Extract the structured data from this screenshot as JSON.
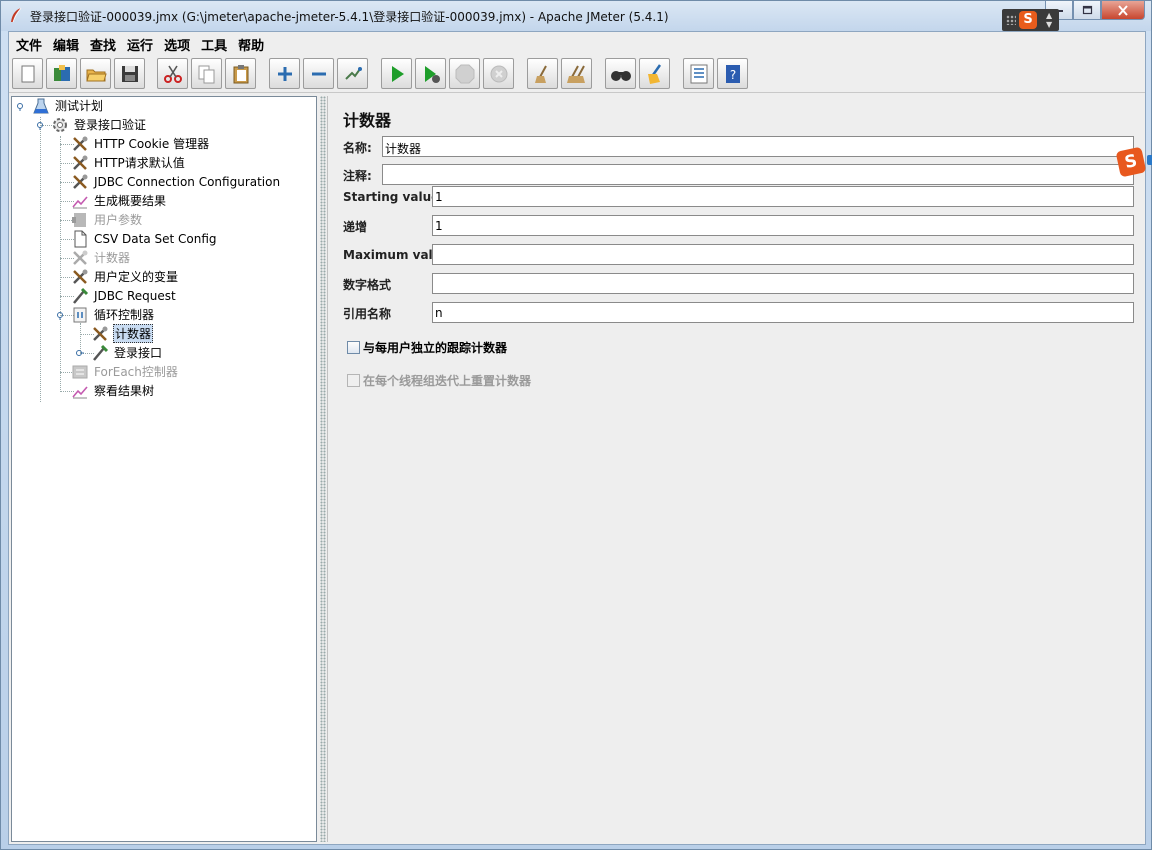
{
  "window": {
    "title": "登录接口验证-000039.jmx (G:\\jmeter\\apache-jmeter-5.4.1\\登录接口验证-000039.jmx) - Apache JMeter (5.4.1)"
  },
  "menu": [
    "文件",
    "编辑",
    "查找",
    "运行",
    "选项",
    "工具",
    "帮助"
  ],
  "toolbar": {
    "icons": [
      "new-icon",
      "templates-icon",
      "open-icon",
      "save-icon",
      "cut-icon",
      "copy-icon",
      "paste-icon",
      "expand-icon",
      "collapse-icon",
      "toggle-icon",
      "start-icon",
      "start-no-pause-icon",
      "stop-icon",
      "shutdown-icon",
      "clear-icon",
      "clear-all-icon",
      "search-icon",
      "reset-search-icon",
      "function-helper-icon",
      "help-icon"
    ]
  },
  "tree": {
    "nodes": [
      {
        "label": "测试计划",
        "icon": "test-plan-icon",
        "disabled": false
      },
      {
        "label": "登录接口验证",
        "icon": "thread-group-icon",
        "disabled": false
      },
      {
        "label": "HTTP Cookie 管理器",
        "icon": "config-element-icon",
        "disabled": false
      },
      {
        "label": "HTTP请求默认值",
        "icon": "config-element-icon",
        "disabled": false
      },
      {
        "label": "JDBC Connection Configuration",
        "icon": "config-element-icon",
        "disabled": false
      },
      {
        "label": "生成概要结果",
        "icon": "listener-icon",
        "disabled": false
      },
      {
        "label": "用户参数",
        "icon": "preprocessor-icon",
        "disabled": true
      },
      {
        "label": "CSV Data Set Config",
        "icon": "csv-file-icon",
        "disabled": false
      },
      {
        "label": "计数器",
        "icon": "config-element-icon",
        "disabled": true
      },
      {
        "label": "用户定义的变量",
        "icon": "config-element-icon",
        "disabled": false
      },
      {
        "label": "JDBC Request",
        "icon": "sampler-icon",
        "disabled": false
      },
      {
        "label": "循环控制器",
        "icon": "loop-controller-icon",
        "disabled": false
      },
      {
        "label": "计数器",
        "icon": "config-element-icon",
        "disabled": false,
        "selected": true
      },
      {
        "label": "登录接口",
        "icon": "sampler-icon",
        "disabled": false
      },
      {
        "label": "ForEach控制器",
        "icon": "foreach-controller-icon",
        "disabled": true
      },
      {
        "label": "察看结果树",
        "icon": "listener-icon",
        "disabled": false
      }
    ]
  },
  "panel": {
    "title": "计数器",
    "name_label": "名称:",
    "name_value": "计数器",
    "comment_label": "注释:",
    "comment_value": "",
    "start_label": "Starting value",
    "start_value": "1",
    "increment_label": "递增",
    "increment_value": "1",
    "max_label": "Maximum value",
    "max_value": "",
    "format_label": "数字格式",
    "format_value": "",
    "refname_label": "引用名称",
    "refname_value": "n",
    "per_user_label": "与每用户独立的跟踪计数器",
    "per_user_checked": false,
    "reset_label": "在每个线程组迭代上重置计数器",
    "reset_checked": false,
    "reset_enabled": false
  },
  "ime": {
    "logo": "S",
    "side_logo": "S"
  }
}
